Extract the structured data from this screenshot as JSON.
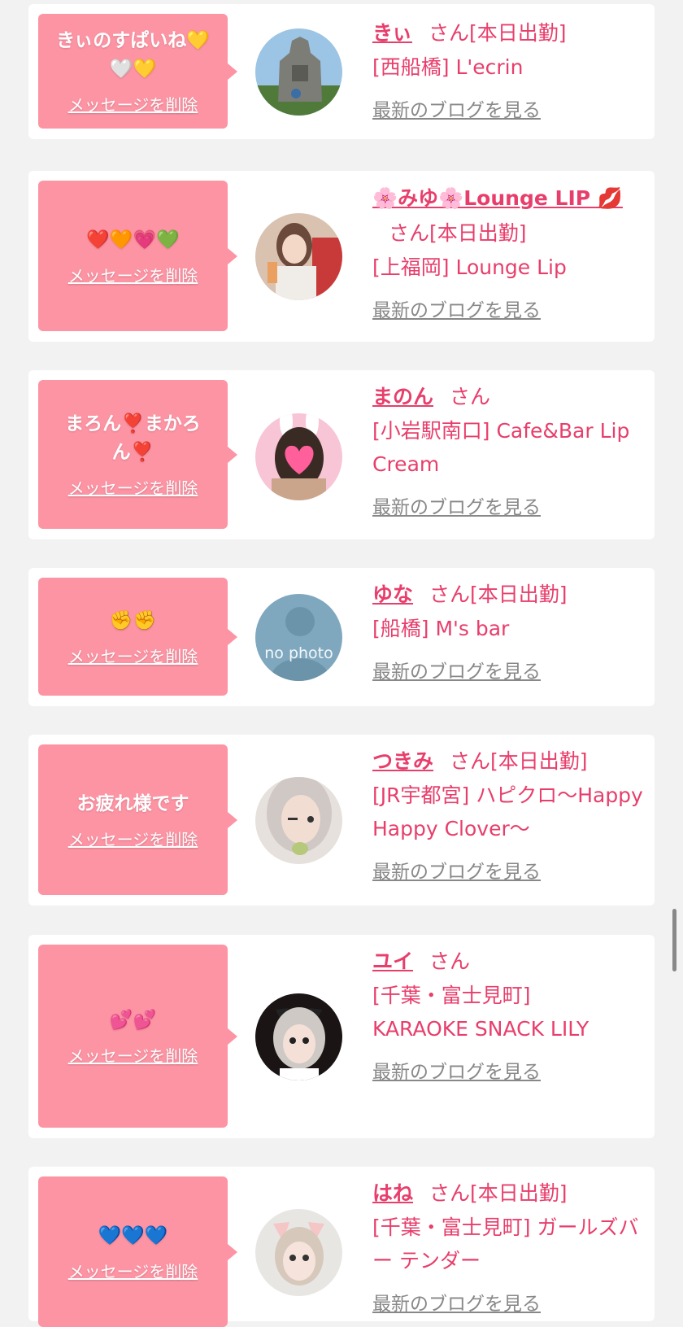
{
  "items": [
    {
      "message": "きぃのすぱいね💛🤍💛",
      "delete_label": "メッセージを削除",
      "name": "きぃ",
      "san": "さん",
      "status": "[本日出勤]",
      "shop": "[西船橋] L'ecrin",
      "blog_label": "最新のブログを見る"
    },
    {
      "message": "❤️🧡💗💚",
      "delete_label": "メッセージを削除",
      "name": "🌸みゆ🌸Lounge LIP 💋",
      "san": "さん",
      "status": "[本日出勤]",
      "shop": "[上福岡] Lounge Lip",
      "blog_label": "最新のブログを見る"
    },
    {
      "message": "まろん❣️まかろん❣️",
      "delete_label": "メッセージを削除",
      "name": "まのん",
      "san": "さん",
      "status": "",
      "shop": "[小岩駅南口] Cafe&Bar Lip Cream",
      "blog_label": "最新のブログを見る"
    },
    {
      "message": "✊✊",
      "delete_label": "メッセージを削除",
      "name": "ゆな",
      "san": "さん",
      "status": "[本日出勤]",
      "shop": "[船橋] M's bar",
      "blog_label": "最新のブログを見る",
      "avatar_text": "no photo"
    },
    {
      "message": "お疲れ様です",
      "delete_label": "メッセージを削除",
      "name": "つきみ",
      "san": "さん",
      "status": "[本日出勤]",
      "shop": "[JR宇都宮] ハピクロ〜Happy Happy Clover〜",
      "blog_label": "最新のブログを見る"
    },
    {
      "message": "💕💕",
      "delete_label": "メッセージを削除",
      "name": "ユイ",
      "san": "さん",
      "status": "",
      "shop": "[千葉・富士見町] KARAOKE SNACK LILY",
      "blog_label": "最新のブログを見る"
    },
    {
      "message": "💙💙💙",
      "delete_label": "メッセージを削除",
      "name": "はね",
      "san": "さん",
      "status": "[本日出勤]",
      "shop": "[千葉・富士見町] ガールズバー テンダー",
      "blog_label": "最新のブログを見る"
    }
  ]
}
